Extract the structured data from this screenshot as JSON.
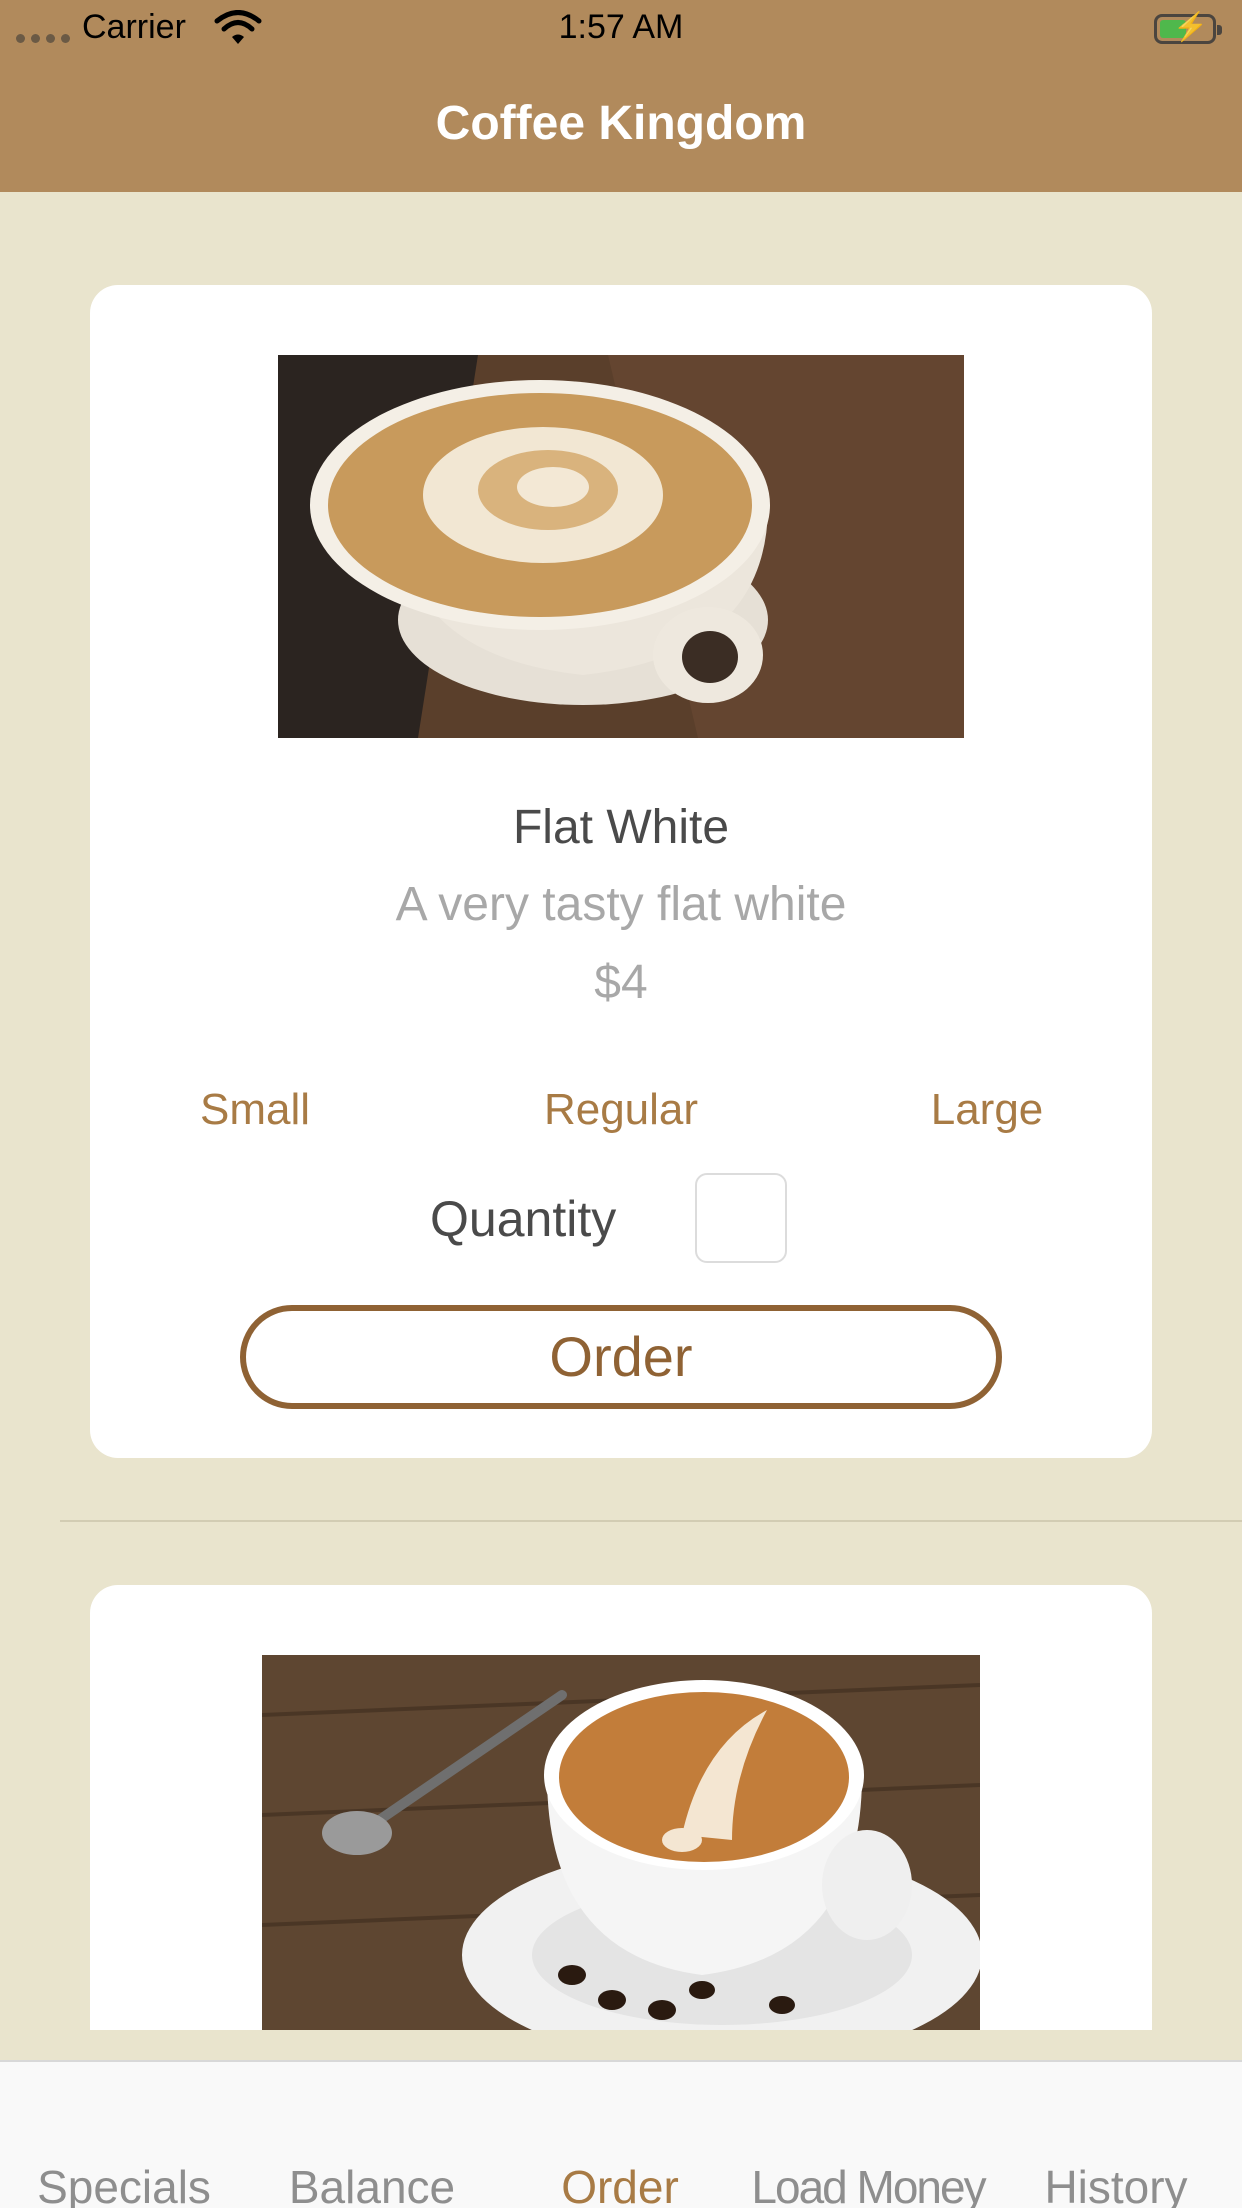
{
  "status_bar": {
    "carrier": "Carrier",
    "time": "1:57 AM"
  },
  "header": {
    "title": "Coffee Kingdom",
    "background_color": "#b18a5c"
  },
  "products": [
    {
      "name": "Flat White",
      "description": "A very tasty flat white",
      "price": "$4",
      "sizes": [
        "Small",
        "Regular",
        "Large"
      ],
      "quantity_label": "Quantity",
      "quantity_value": "",
      "order_label": "Order"
    }
  ],
  "tabbar": {
    "tabs": [
      {
        "label": "Specials"
      },
      {
        "label": "Balance"
      },
      {
        "label": "Order"
      },
      {
        "label": "Load Money"
      },
      {
        "label": "History"
      }
    ],
    "active_tab": "Order",
    "accent_color": "#a87b45"
  },
  "colors": {
    "page_background": "#e9e4cd",
    "accent": "#a87b45"
  }
}
